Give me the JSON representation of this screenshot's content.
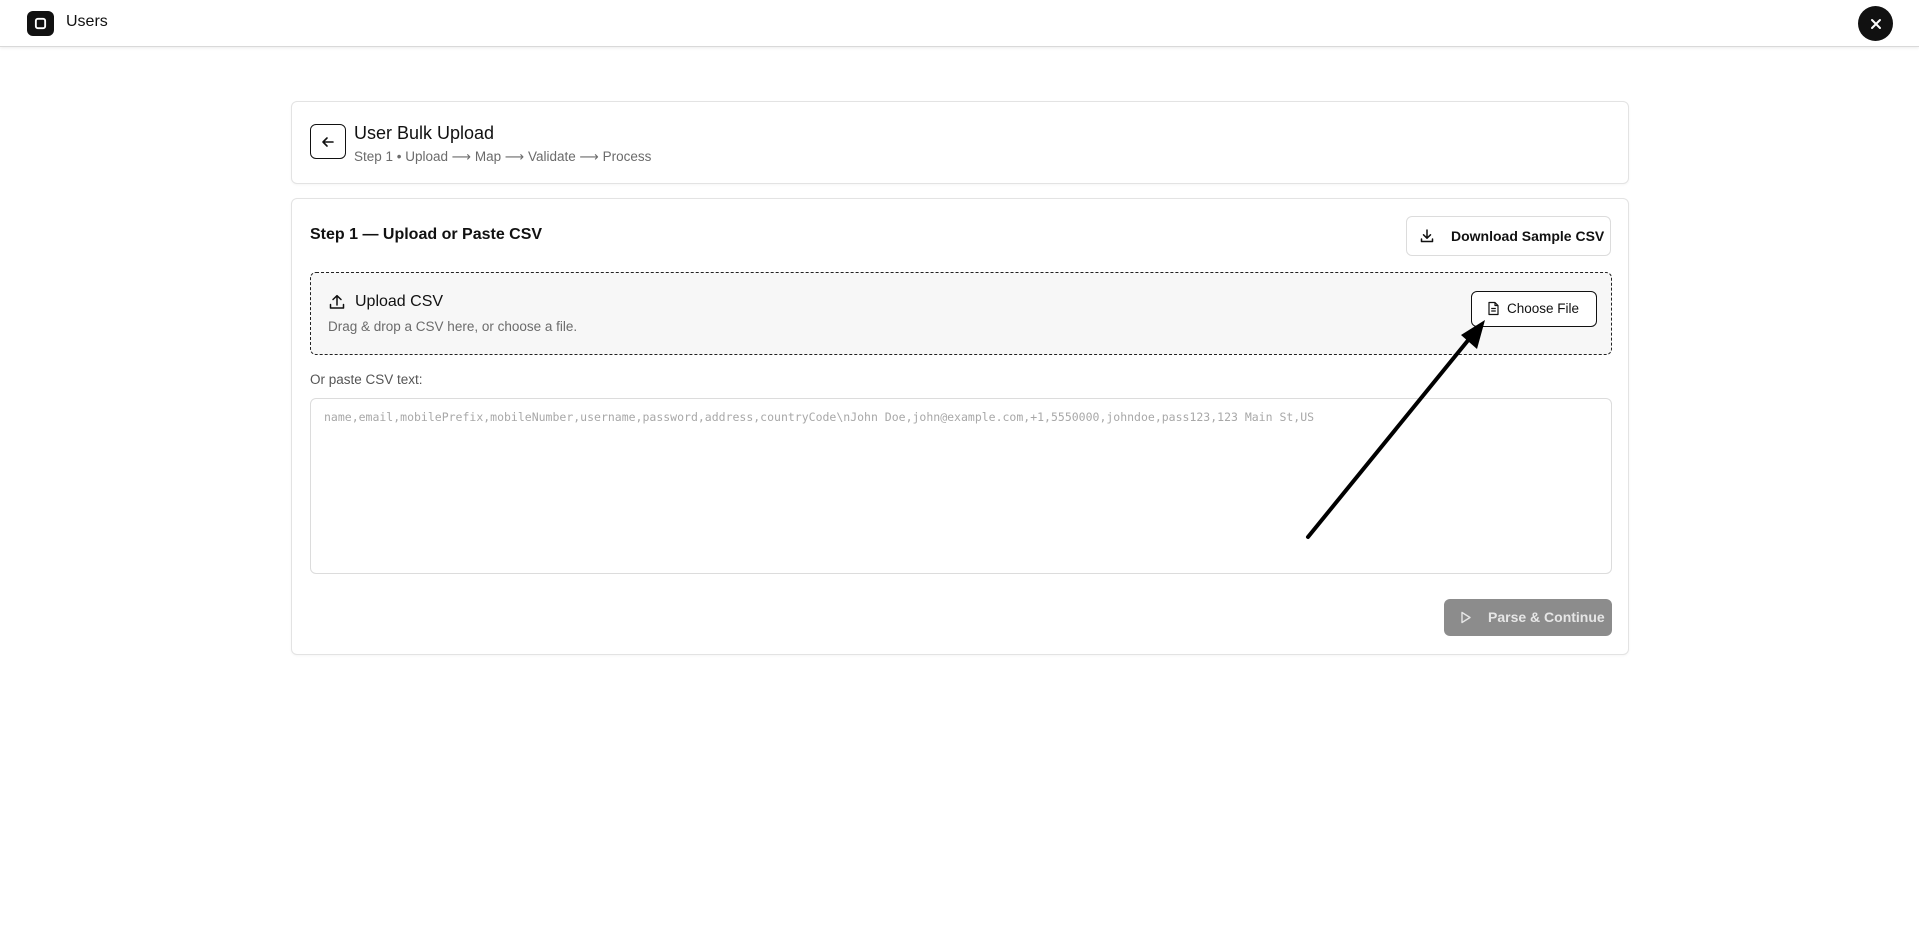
{
  "topbar": {
    "title": "Users",
    "app_icon": "square-app-icon",
    "close_icon": "close-icon"
  },
  "header": {
    "back_icon": "arrow-left-icon",
    "title": "User Bulk Upload",
    "subtitle": "Step 1 • Upload ⟶ Map ⟶ Validate ⟶ Process"
  },
  "step": {
    "title": "Step 1 — Upload or Paste CSV",
    "download_label": "Download Sample CSV",
    "download_icon": "download-icon"
  },
  "upload": {
    "title": "Upload CSV",
    "subtitle": "Drag & drop a CSV here, or choose a file.",
    "choose_label": "Choose File",
    "upload_icon": "upload-icon",
    "file_icon": "file-icon"
  },
  "paste": {
    "label": "Or paste CSV text:",
    "value": "",
    "placeholder": "name,email,mobilePrefix,mobileNumber,username,password,address,countryCode\\nJohn Doe,john@example.com,+1,5550000,johndoe,pass123,123 Main St,US"
  },
  "actions": {
    "parse_label": "Parse & Continue",
    "parse_icon": "play-icon",
    "parse_disabled": true
  },
  "colors": {
    "accent": "#111111",
    "disabled_button": "#8c8c8c",
    "dropzone_bg": "#f7f7f7",
    "muted_text": "#6b6b6b"
  }
}
